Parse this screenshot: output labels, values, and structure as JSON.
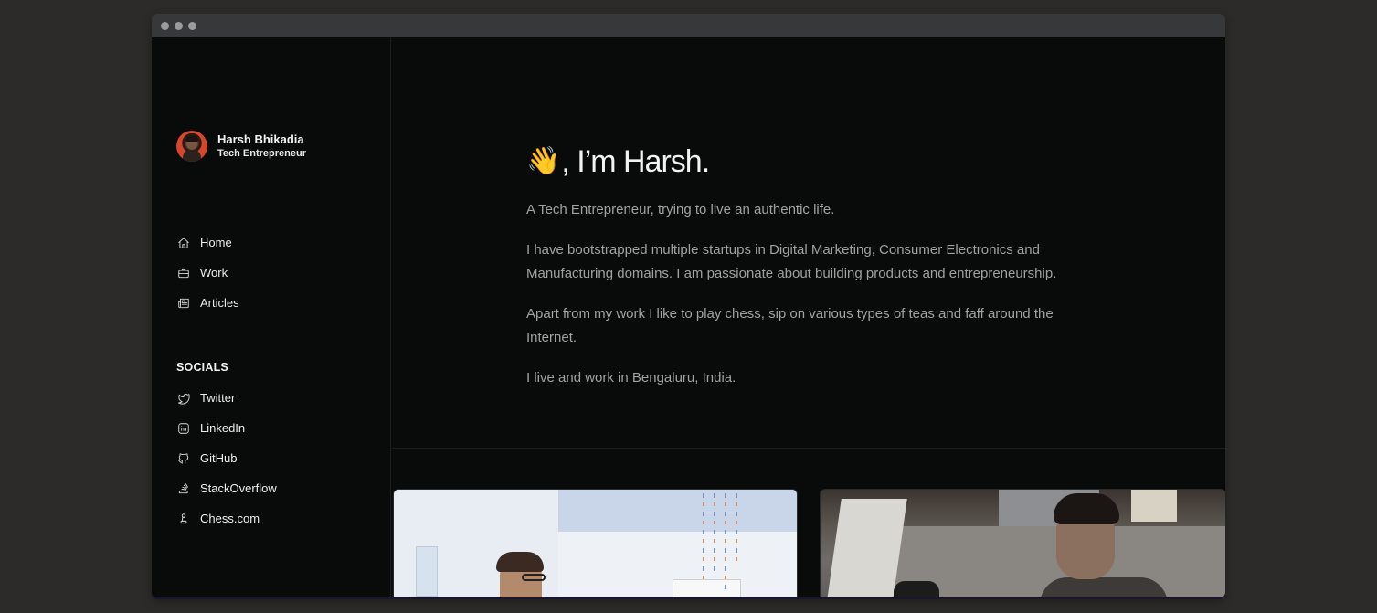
{
  "window": {
    "controls": [
      "close",
      "minimize",
      "maximize"
    ]
  },
  "sidebar": {
    "profile": {
      "name": "Harsh Bhikadia",
      "role": "Tech Entrepreneur",
      "avatar_color": "#d5462a"
    },
    "nav": [
      {
        "label": "Home",
        "icon": "home-icon"
      },
      {
        "label": "Work",
        "icon": "briefcase-icon"
      },
      {
        "label": "Articles",
        "icon": "newspaper-icon"
      }
    ],
    "socials_title": "SOCIALS",
    "socials": [
      {
        "label": "Twitter",
        "icon": "twitter-icon"
      },
      {
        "label": "LinkedIn",
        "icon": "linkedin-icon"
      },
      {
        "label": "GitHub",
        "icon": "github-icon"
      },
      {
        "label": "StackOverflow",
        "icon": "stackoverflow-icon"
      },
      {
        "label": "Chess.com",
        "icon": "chess-pawn-icon"
      }
    ]
  },
  "main": {
    "wave_emoji": "👋",
    "headline": ", I’m Harsh.",
    "paragraphs": [
      "A Tech Entrepreneur, trying to live an authentic life.",
      "I have bootstrapped multiple startups in Digital Marketing, Consumer Electronics and Manufacturing domains. I am passionate about building products and entrepreneurship.",
      "Apart from my work I like to play chess, sip on various types of teas and faff around the Internet.",
      "I live and work in Bengaluru, India."
    ],
    "photos": [
      {
        "alt": "photo-office-discussion"
      },
      {
        "alt": "photo-working-on-laptop"
      }
    ]
  },
  "colors": {
    "page_bg": "#2c2b2a",
    "window_bg": "#090a0a",
    "titlebar": "#37383a",
    "text_primary": "#f2f2f2",
    "text_secondary": "#a1a1a1"
  }
}
